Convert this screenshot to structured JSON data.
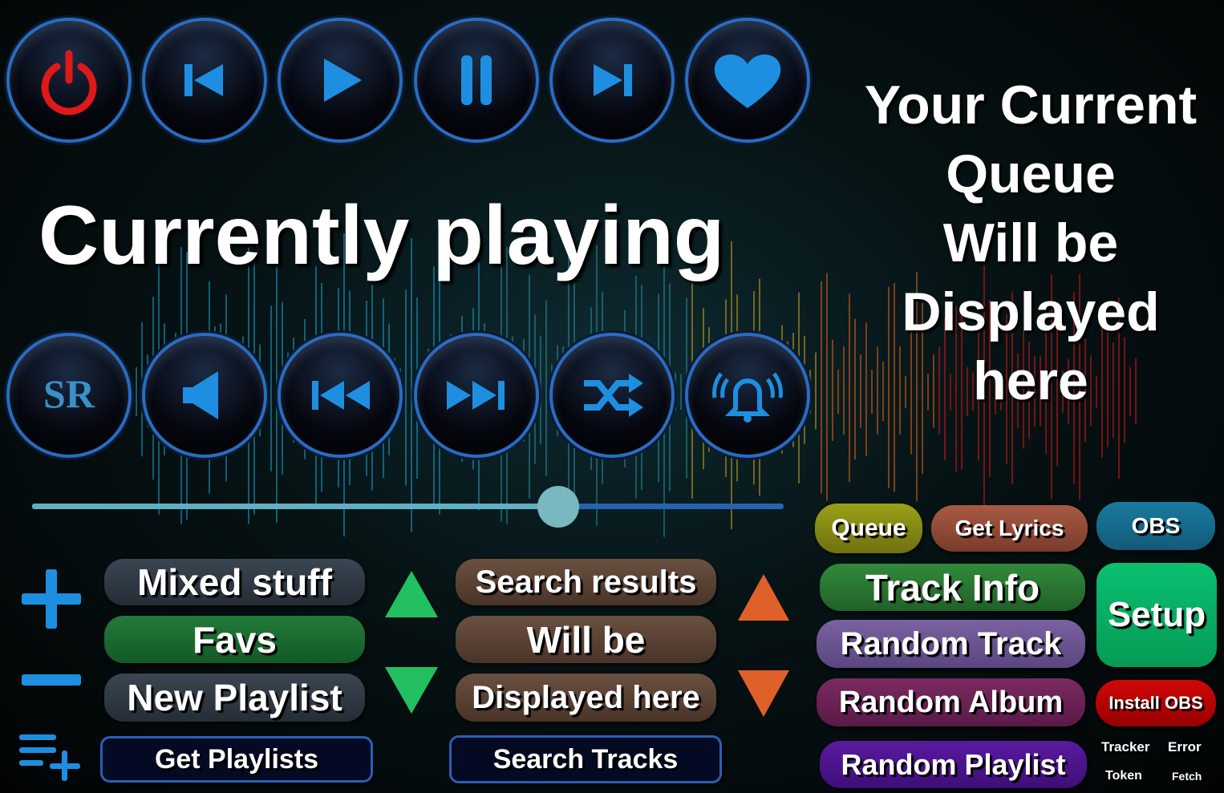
{
  "header": {
    "title": "Currently playing"
  },
  "queue": {
    "lines": [
      "Your Current",
      "Queue",
      "Will be",
      "Displayed",
      "here"
    ]
  },
  "controls_top": [
    {
      "name": "power-button",
      "icon": "power-icon"
    },
    {
      "name": "previous-button",
      "icon": "skip-previous-icon"
    },
    {
      "name": "play-button",
      "icon": "play-icon"
    },
    {
      "name": "pause-button",
      "icon": "pause-icon"
    },
    {
      "name": "next-button",
      "icon": "skip-next-icon"
    },
    {
      "name": "favorite-button",
      "icon": "heart-icon"
    }
  ],
  "controls_bottom": [
    {
      "name": "song-request-button",
      "icon": "sr-icon",
      "label": "SR"
    },
    {
      "name": "volume-button",
      "icon": "speaker-icon"
    },
    {
      "name": "rewind-button",
      "icon": "rewind-icon"
    },
    {
      "name": "fast-forward-button",
      "icon": "fast-forward-icon"
    },
    {
      "name": "shuffle-button",
      "icon": "shuffle-icon"
    },
    {
      "name": "alert-button",
      "icon": "bell-ring-icon"
    }
  ],
  "progress": {
    "value_percent": 70
  },
  "playlists": {
    "items": [
      "Mixed stuff",
      "Favs",
      "New Playlist"
    ],
    "get_label": "Get Playlists"
  },
  "search": {
    "items": [
      "Search results",
      "Will be",
      "Displayed here"
    ],
    "search_label": "Search Tracks"
  },
  "right": {
    "queue": "Queue",
    "lyrics": "Get Lyrics",
    "obs": "OBS",
    "track_info": "Track Info",
    "setup": "Setup",
    "random_track": "Random Track",
    "random_album": "Random Album",
    "install_obs": "Install OBS",
    "random_playlist": "Random Playlist",
    "tracker": "Tracker",
    "error": "Error",
    "token": "Token",
    "fetch": "Fetch"
  },
  "colors": {
    "accent": "#2a6cc0",
    "icon": "#1e8fe0",
    "power": "#e01818"
  }
}
